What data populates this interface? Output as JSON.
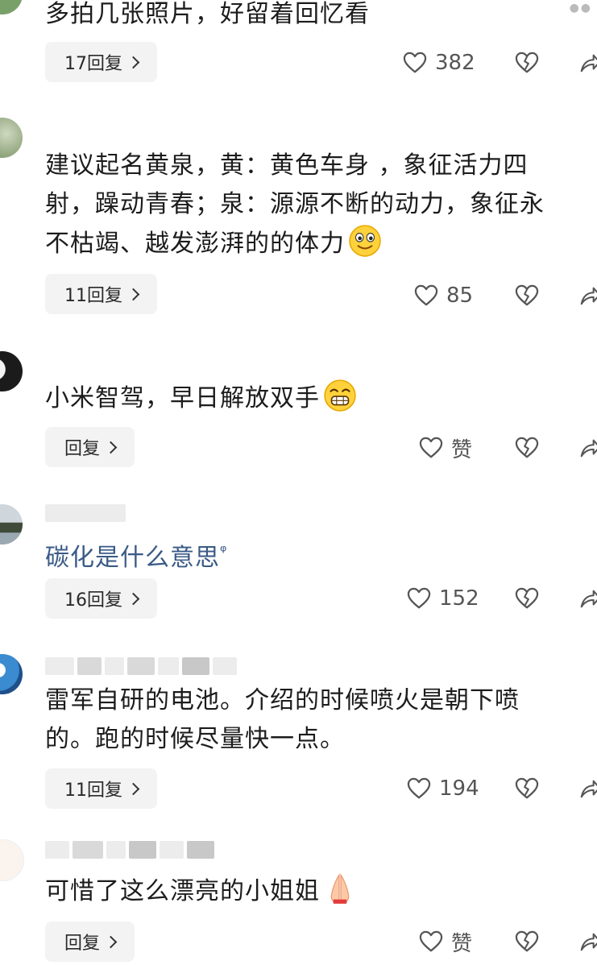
{
  "comments": [
    {
      "text": "多拍几张照片，好留着回忆看",
      "reply_label": "17回复",
      "likes": "382"
    },
    {
      "text_line1": "建议起名黄泉，黄：黄色车身 ，象征活力四",
      "text_line2": "射，躁动青春；泉：源源不断的动力，象征永",
      "text_line3": "不枯竭、越发澎湃的的体力",
      "emoji": "smile-emoji",
      "reply_label": "11回复",
      "likes": "85"
    },
    {
      "text": "小米智驾，早日解放双手",
      "emoji": "grin-emoji",
      "reply_label": "回复",
      "likes": "赞"
    },
    {
      "text": "碳化是什么意思",
      "search_hint": "ᵠ",
      "reply_label": "16回复",
      "likes": "152"
    },
    {
      "text_line1": "雷军自研的电池。介绍的时候喷火是朝下喷",
      "text_line2": "的。跑的时候尽量快一点。",
      "reply_label": "11回复",
      "likes": "194"
    },
    {
      "text": "可惜了这么漂亮的小姐姐",
      "emoji": "pray-hands-emoji",
      "reply_label": "回复",
      "likes": "赞"
    }
  ],
  "colors": {
    "text": "#1c1c1c",
    "link": "#3a5a86",
    "reply_bg": "#f3f3f3",
    "icon": "#666666"
  }
}
